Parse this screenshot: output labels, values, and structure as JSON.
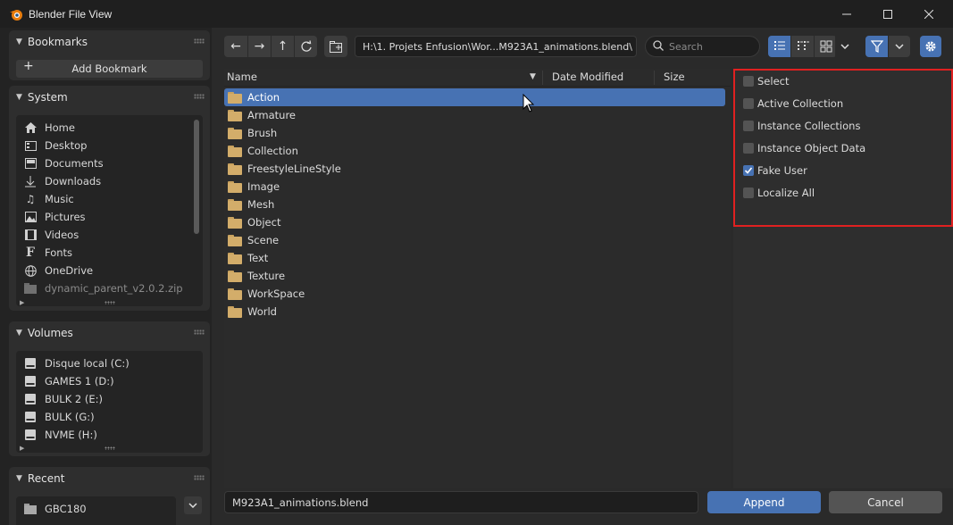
{
  "window": {
    "title": "Blender File View"
  },
  "sidebar": {
    "bookmarks": {
      "title": "Bookmarks",
      "add_label": "Add Bookmark"
    },
    "system": {
      "title": "System",
      "items": [
        {
          "label": "Home",
          "icon": "home-icon"
        },
        {
          "label": "Desktop",
          "icon": "desktop-icon"
        },
        {
          "label": "Documents",
          "icon": "documents-icon"
        },
        {
          "label": "Downloads",
          "icon": "downloads-icon"
        },
        {
          "label": "Music",
          "icon": "music-icon"
        },
        {
          "label": "Pictures",
          "icon": "pictures-icon"
        },
        {
          "label": "Videos",
          "icon": "videos-icon"
        },
        {
          "label": "Fonts",
          "icon": "fonts-icon"
        },
        {
          "label": "OneDrive",
          "icon": "globe-icon"
        },
        {
          "label": "dynamic_parent_v2.0.2.zip",
          "icon": "folder-icon"
        }
      ]
    },
    "volumes": {
      "title": "Volumes",
      "items": [
        {
          "label": "Disque local (C:)"
        },
        {
          "label": "GAMES 1 (D:)"
        },
        {
          "label": "BULK 2 (E:)"
        },
        {
          "label": "BULK (G:)"
        },
        {
          "label": "NVME (H:)"
        }
      ]
    },
    "recent": {
      "title": "Recent",
      "items": [
        {
          "label": "GBC180"
        }
      ]
    }
  },
  "toolbar": {
    "path": "H:\\1. Projets Enfusion\\Wor...M923A1_animations.blend\\",
    "search_placeholder": "Search"
  },
  "filelist": {
    "columns": {
      "name": "Name",
      "date": "Date Modified",
      "size": "Size"
    },
    "rows": [
      {
        "name": "Action"
      },
      {
        "name": "Armature"
      },
      {
        "name": "Brush"
      },
      {
        "name": "Collection"
      },
      {
        "name": "FreestyleLineStyle"
      },
      {
        "name": "Image"
      },
      {
        "name": "Mesh"
      },
      {
        "name": "Object"
      },
      {
        "name": "Scene"
      },
      {
        "name": "Text"
      },
      {
        "name": "Texture"
      },
      {
        "name": "WorkSpace"
      },
      {
        "name": "World"
      }
    ],
    "selected_index": 0
  },
  "options": [
    {
      "label": "Select",
      "checked": false
    },
    {
      "label": "Active Collection",
      "checked": false
    },
    {
      "label": "Instance Collections",
      "checked": false
    },
    {
      "label": "Instance Object Data",
      "checked": false
    },
    {
      "label": "Fake User",
      "checked": true
    },
    {
      "label": "Localize All",
      "checked": false
    }
  ],
  "bottom": {
    "filename": "M923A1_animations.blend",
    "append_label": "Append",
    "cancel_label": "Cancel"
  },
  "colors": {
    "accent": "#4772b3",
    "highlight": "#e02020",
    "folder": "#d3ad6a"
  }
}
